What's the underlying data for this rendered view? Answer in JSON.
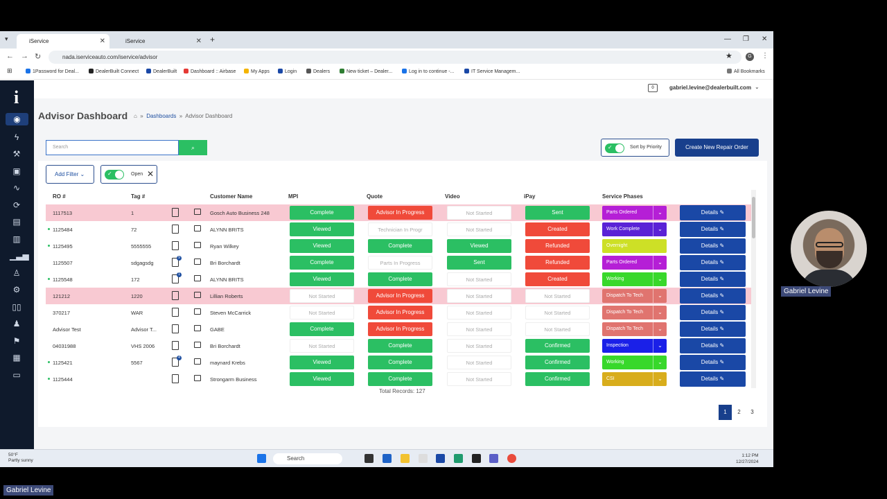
{
  "browser": {
    "tabs": [
      {
        "label": "iService"
      },
      {
        "label": "iService"
      }
    ],
    "url": "nada.iserviceauto.com/iservice/advisor",
    "bookmarks": [
      {
        "label": "1Password for Deal...",
        "color": "#1a73e8"
      },
      {
        "label": "DealerBuilt Connect",
        "color": "#222"
      },
      {
        "label": "DealerBuilt",
        "color": "#1a48a6"
      },
      {
        "label": "Dashboard :: Airbase",
        "color": "#e53935"
      },
      {
        "label": "My Apps",
        "color": "#f4b400"
      },
      {
        "label": "Login",
        "color": "#1a48a6"
      },
      {
        "label": "Dealers",
        "color": "#555"
      },
      {
        "label": "New ticket – Dealer...",
        "color": "#2e7d32"
      },
      {
        "label": "Log in to continue -...",
        "color": "#1a73e8"
      },
      {
        "label": "IT Service Managem...",
        "color": "#1a48a6"
      }
    ],
    "all_bookmarks": "All Bookmarks"
  },
  "app": {
    "user": "gabriel.levine@dealerbuilt.com",
    "page_title": "Advisor Dashboard",
    "breadcrumb": {
      "dashboards": "Dashboards",
      "current": "Advisor Dashboard"
    },
    "search_placeholder": "Search",
    "sort_label": "Sort by Priority",
    "create_label": "Create New Repair Order",
    "add_filter": "Add Filter",
    "open_label": "Open",
    "columns": [
      "RO #",
      "Tag #",
      "Customer Name",
      "MPI",
      "Quote",
      "Video",
      "iPay",
      "Service Phases"
    ],
    "details_label": "Details",
    "total": "Total Records: 127",
    "pages": [
      "1",
      "2",
      "3"
    ]
  },
  "rows": [
    {
      "ro": "1117513",
      "tag": "1",
      "name": "Gosch Auto Business 248",
      "dot": false,
      "pink": true,
      "badge": "",
      "mpi": "Complete",
      "quote": "Advisor In Progress",
      "video": "Not Started",
      "ipay": "Sent",
      "phase": "Parts Ordered",
      "phase_color": "#b51fd6",
      "dd": true
    },
    {
      "ro": "1125484",
      "tag": "72",
      "name": "ALYNN BRITS",
      "dot": true,
      "pink": false,
      "badge": "",
      "mpi": "Viewed",
      "quote": "Technician In Progr",
      "video": "Not Started",
      "ipay": "Created",
      "phase": "Work Complete",
      "phase_color": "#5a22d6",
      "dd": true
    },
    {
      "ro": "1125495",
      "tag": "5555555",
      "name": "Ryan Wilkey",
      "dot": true,
      "pink": false,
      "badge": "",
      "mpi": "Viewed",
      "quote": "Complete",
      "video": "Viewed",
      "ipay": "Refunded",
      "phase": "Overnight",
      "phase_color": "#cde026",
      "dd": false
    },
    {
      "ro": "1125507",
      "tag": "sdgagsdg",
      "name": "Bri Borchardt",
      "dot": false,
      "pink": false,
      "badge": "9",
      "mpi": "Complete",
      "quote": "Parts In Progress",
      "video": "Sent",
      "ipay": "Refunded",
      "phase": "Parts Ordered",
      "phase_color": "#b51fd6",
      "dd": true
    },
    {
      "ro": "1125548",
      "tag": "172",
      "name": "ALYNN BRITS",
      "dot": true,
      "pink": false,
      "badge": "1",
      "mpi": "Viewed",
      "quote": "Complete",
      "video": "Not Started",
      "ipay": "Created",
      "phase": "Working",
      "phase_color": "#38d82b",
      "dd": true
    },
    {
      "ro": "121212",
      "tag": "1220",
      "name": "Lillian Roberts",
      "dot": false,
      "pink": true,
      "badge": "",
      "mpi": "Not Started",
      "quote": "Advisor In Progress",
      "video": "Not Started",
      "ipay": "Not Started",
      "phase": "Dispatch To Tech",
      "phase_color": "#e0746f",
      "dd": true
    },
    {
      "ro": "370217",
      "tag": "WAR",
      "name": "Steven McCarrick",
      "dot": false,
      "pink": false,
      "badge": "",
      "mpi": "Not Started",
      "quote": "Advisor In Progress",
      "video": "Not Started",
      "ipay": "Not Started",
      "phase": "Dispatch To Tech",
      "phase_color": "#e0746f",
      "dd": true
    },
    {
      "ro": "Advisor Test",
      "tag": "Advisor T...",
      "name": "GABE",
      "dot": false,
      "pink": false,
      "badge": "",
      "mpi": "Complete",
      "quote": "Advisor In Progress",
      "video": "Not Started",
      "ipay": "Not Started",
      "phase": "Dispatch To Tech",
      "phase_color": "#e0746f",
      "dd": true
    },
    {
      "ro": "04031988",
      "tag": "VHS 2006",
      "name": "Bri Borchardt",
      "dot": false,
      "pink": false,
      "badge": "",
      "mpi": "Not Started",
      "quote": "Complete",
      "video": "Not Started",
      "ipay": "Confirmed",
      "phase": "Inspection",
      "phase_color": "#1a20e8",
      "dd": true
    },
    {
      "ro": "1125421",
      "tag": "5567",
      "name": "maynard Krebs",
      "dot": true,
      "pink": false,
      "badge": "4",
      "mpi": "Viewed",
      "quote": "Complete",
      "video": "Not Started",
      "ipay": "Confirmed",
      "phase": "Working",
      "phase_color": "#38d82b",
      "dd": true
    },
    {
      "ro": "1125444",
      "tag": "",
      "name": "Strongarm Business",
      "dot": true,
      "pink": false,
      "badge": "",
      "mpi": "Viewed",
      "quote": "Complete",
      "video": "Not Started",
      "ipay": "Confirmed",
      "phase": "CSI",
      "phase_color": "#d8ad1c",
      "dd": true
    }
  ],
  "taskbar": {
    "temp": "50°F",
    "weather": "Partly sunny",
    "search": "Search",
    "time": "1:12 PM",
    "date": "12/27/2024"
  },
  "participants": {
    "webcam_name": "Gabriel Levine",
    "corner_name": "Gabriel Levine"
  }
}
